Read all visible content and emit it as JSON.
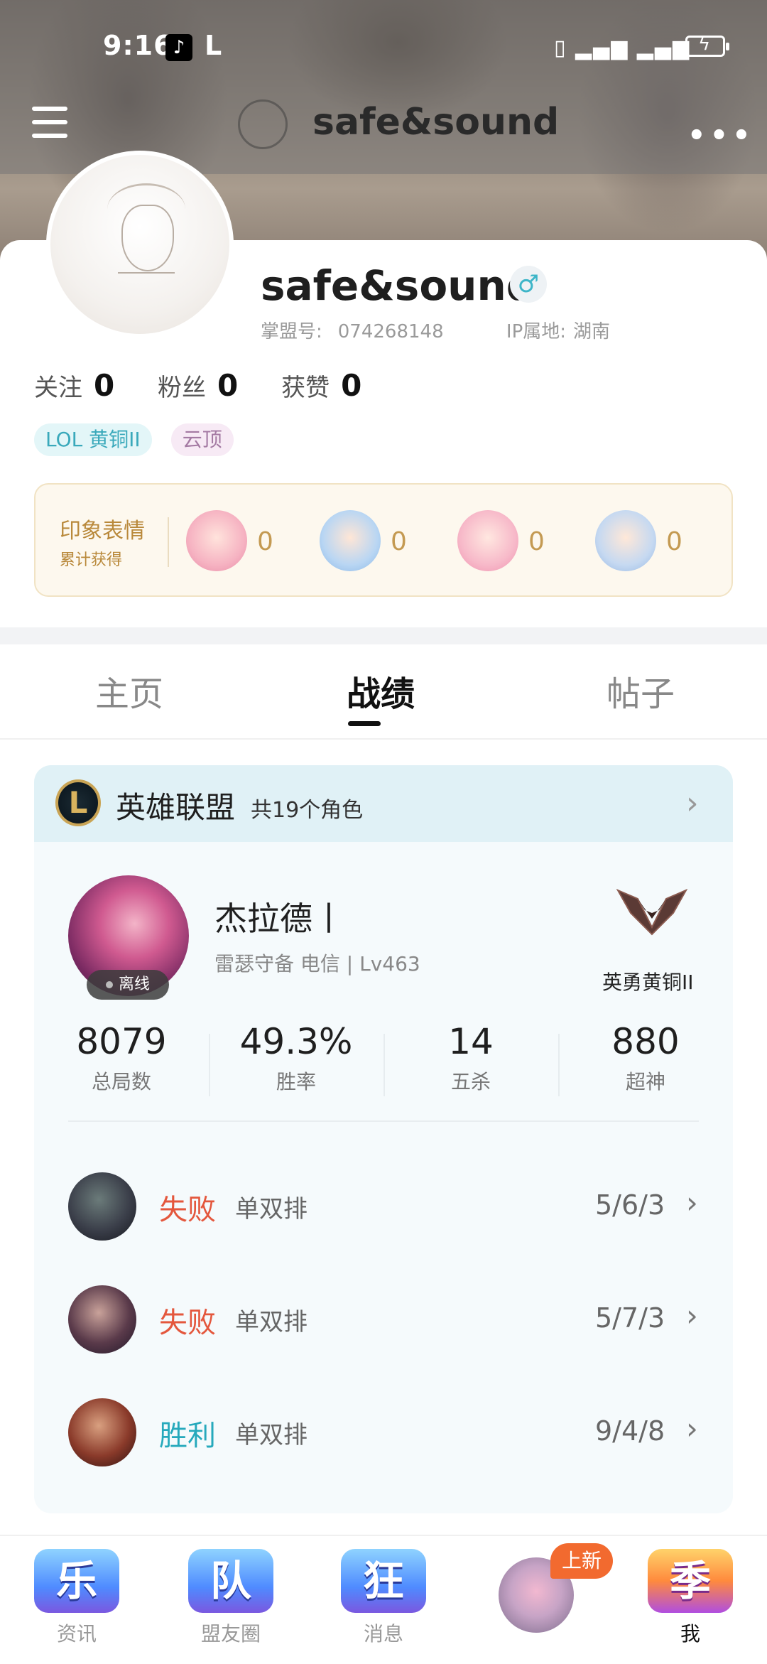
{
  "status_bar": {
    "time": "9:16",
    "app_icon_1": "tiktok-icon",
    "app_icon_2": "L",
    "signal": "4G 4G"
  },
  "nav": {
    "title": "safe&sound",
    "menu_icon": "hamburger-icon",
    "more_icon": "more-horizontal-icon"
  },
  "profile": {
    "name": "safe&sound",
    "gender_symbol": "♂",
    "account_label": "掌盟号:",
    "account_id": "074268148",
    "ip_label": "IP属地:",
    "ip_location": "湖南",
    "stats": [
      {
        "label": "关注",
        "value": "0"
      },
      {
        "label": "粉丝",
        "value": "0"
      },
      {
        "label": "获赞",
        "value": "0"
      }
    ],
    "tags": [
      "LOL 黄铜II",
      "云顶"
    ]
  },
  "emoji_box": {
    "title": "印象表情",
    "subtitle": "累计获得",
    "items": [
      {
        "icon": "emoji-cry-icon",
        "count": "0",
        "color": "#f6b3c2"
      },
      {
        "icon": "emoji-wave-icon",
        "count": "0",
        "color": "#b9d6f3"
      },
      {
        "icon": "emoji-love-icon",
        "count": "0",
        "color": "#f7b9c9"
      },
      {
        "icon": "emoji-gg-icon",
        "count": "0",
        "color": "#c6d9f1"
      }
    ]
  },
  "tabs": [
    {
      "label": "主页",
      "active": false
    },
    {
      "label": "战绩",
      "active": true
    },
    {
      "label": "帖子",
      "active": false
    }
  ],
  "game": {
    "name": "英雄联盟",
    "role_count": "共19个角色",
    "champion": {
      "name": "杰拉德丨",
      "server": "雷瑟守备 电信 | Lv463",
      "status": "离线",
      "rank": "英勇黄铜II"
    },
    "summary": [
      {
        "value": "8079",
        "label": "总局数"
      },
      {
        "value": "49.3%",
        "label": "胜率"
      },
      {
        "value": "14",
        "label": "五杀"
      },
      {
        "value": "880",
        "label": "超神"
      }
    ],
    "matches": [
      {
        "result": "失败",
        "outcome": "lose",
        "type": "单双排",
        "kda": "5/6/3"
      },
      {
        "result": "失败",
        "outcome": "lose",
        "type": "单双排",
        "kda": "5/7/3"
      },
      {
        "result": "胜利",
        "outcome": "win",
        "type": "单双排",
        "kda": "9/4/8"
      }
    ]
  },
  "bottom_nav": {
    "items": [
      {
        "glyph": "乐",
        "label": "资讯"
      },
      {
        "glyph": "队",
        "label": "盟友圈"
      },
      {
        "glyph": "狂",
        "label": "消息"
      },
      {
        "glyph": "",
        "label": ""
      },
      {
        "glyph": "季",
        "label": "我"
      }
    ],
    "new_badge": "上新"
  }
}
